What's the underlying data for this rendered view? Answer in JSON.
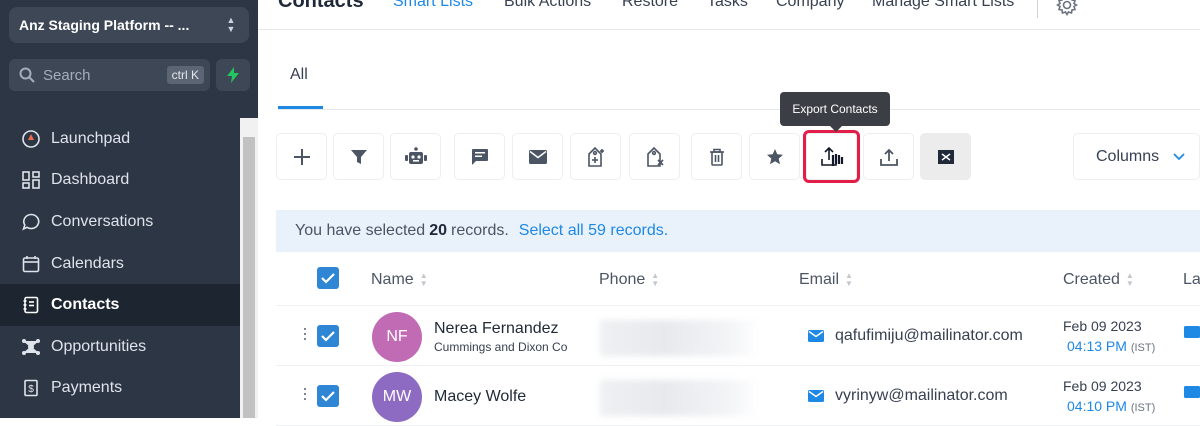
{
  "sidebar": {
    "location": "Anz Staging Platform -- ...",
    "search": {
      "placeholder": "Search",
      "shortcut": "ctrl K"
    },
    "items": [
      {
        "label": "Launchpad",
        "icon": "rocket-icon"
      },
      {
        "label": "Dashboard",
        "icon": "grid-icon"
      },
      {
        "label": "Conversations",
        "icon": "chat-icon"
      },
      {
        "label": "Calendars",
        "icon": "calendar-icon"
      },
      {
        "label": "Contacts",
        "icon": "contact-book-icon",
        "active": true
      },
      {
        "label": "Opportunities",
        "icon": "network-icon"
      },
      {
        "label": "Payments",
        "icon": "payment-icon"
      }
    ]
  },
  "header": {
    "title": "Contacts",
    "tabs": [
      "Smart Lists",
      "Bulk Actions",
      "Restore",
      "Tasks",
      "Company",
      "Manage Smart Lists"
    ],
    "active_tab": "Smart Lists"
  },
  "subtabs": {
    "all": "All"
  },
  "toolbar": {
    "buttons": [
      "add-icon",
      "filter-icon",
      "robot-icon",
      "sms-icon",
      "email-icon",
      "tag-add-icon",
      "tag-remove-icon",
      "trash-icon",
      "star-icon",
      "export-icon",
      "import-icon",
      "merge-icon"
    ],
    "tooltip": "Export Contacts",
    "columns_label": "Columns"
  },
  "selection": {
    "prefix": "You have selected",
    "count": "20",
    "suffix": "records.",
    "link": "Select all 59 records."
  },
  "table": {
    "headers": {
      "name": "Name",
      "phone": "Phone",
      "email": "Email",
      "created": "Created",
      "last": "La"
    },
    "rows": [
      {
        "initials": "NF",
        "name": "Nerea Fernandez",
        "company": "Cummings and Dixon Co",
        "email": "qafufimiju@mailinator.com",
        "date": "Feb 09 2023",
        "time": "04:13 PM",
        "tz": "(IST)",
        "avatar_color": "#c26bb5"
      },
      {
        "initials": "MW",
        "name": "Macey Wolfe",
        "company": "",
        "email": "vyrinyw@mailinator.com",
        "date": "Feb 09 2023",
        "time": "04:10 PM",
        "tz": "(IST)",
        "avatar_color": "#8e6bc2"
      }
    ]
  },
  "colors": {
    "accent": "#1e88e5",
    "sidebar_bg": "#2c3645",
    "highlight": "#e11d48"
  }
}
